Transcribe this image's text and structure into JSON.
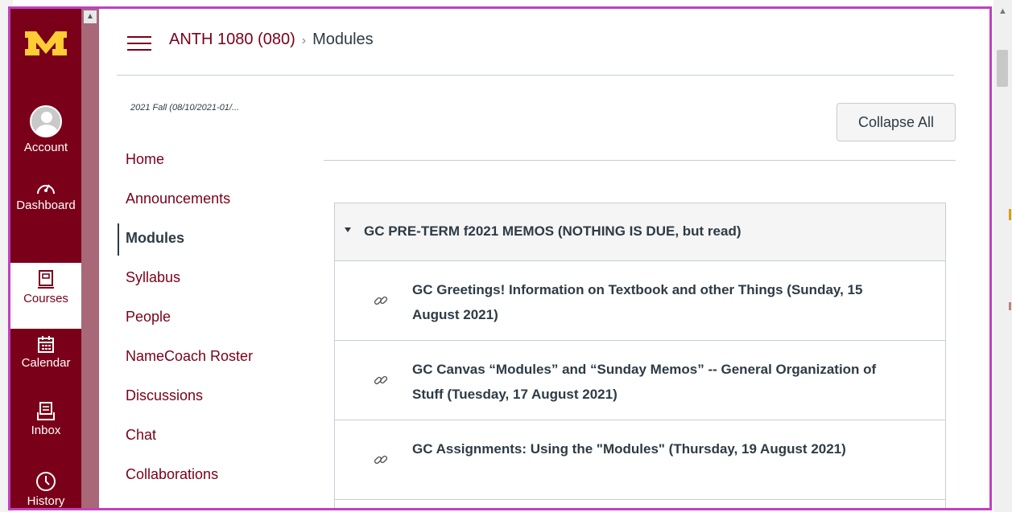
{
  "global_nav": {
    "items": [
      {
        "label": "Account",
        "icon": "avatar-icon"
      },
      {
        "label": "Dashboard",
        "icon": "dashboard-icon"
      },
      {
        "label": "Courses",
        "icon": "courses-icon"
      },
      {
        "label": "Calendar",
        "icon": "calendar-icon"
      },
      {
        "label": "Inbox",
        "icon": "inbox-icon"
      },
      {
        "label": "History",
        "icon": "history-icon"
      }
    ],
    "brand_color": "#7a0019",
    "logo_color": "#ffcc33"
  },
  "breadcrumb": {
    "course": "ANTH 1080 (080)",
    "separator": "›",
    "current": "Modules"
  },
  "course_nav": {
    "term": "2021 Fall (08/10/2021-01/...",
    "items": [
      {
        "label": "Home"
      },
      {
        "label": "Announcements"
      },
      {
        "label": "Modules",
        "active": true
      },
      {
        "label": "Syllabus"
      },
      {
        "label": "People"
      },
      {
        "label": "NameCoach Roster"
      },
      {
        "label": "Discussions"
      },
      {
        "label": "Chat"
      },
      {
        "label": "Collaborations"
      }
    ]
  },
  "toolbar": {
    "collapse_all_label": "Collapse All"
  },
  "module": {
    "title": "GC PRE-TERM f2021 MEMOS (NOTHING IS DUE, but read)",
    "items": [
      {
        "title": "GC Greetings! Information on Textbook and other Things (Sunday, 15 August 2021)",
        "icon": "link-icon"
      },
      {
        "title": "GC Canvas “Modules” and “Sunday Memos” -- General Organization of Stuff (Tuesday, 17 August 2021)",
        "icon": "link-icon"
      },
      {
        "title": "GC Assignments: Using the \"Modules\" (Thursday, 19 August 2021)",
        "icon": "link-icon"
      }
    ]
  }
}
